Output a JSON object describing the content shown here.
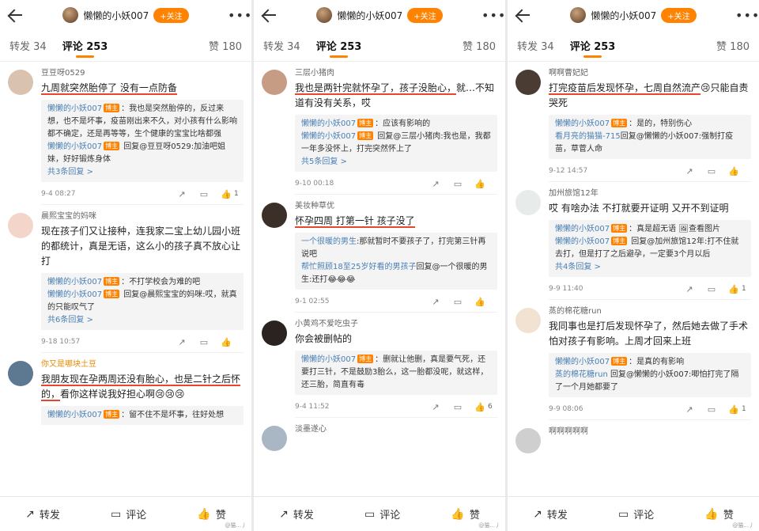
{
  "header": {
    "name": "懒懒的小妖007",
    "follow": "+关注"
  },
  "tabs": {
    "repost": "转发 34",
    "comment": "评论 253",
    "like": "赞 180"
  },
  "bottom": {
    "repost": "转发",
    "comment": "评论",
    "like": "赞"
  },
  "tag": "博主",
  "panels": [
    {
      "comments": [
        {
          "user": "豆豆呀0529",
          "text_ul": "九周就突然胎停了 没有一点防备",
          "text_rest": "",
          "replies": [
            {
              "name": "懒懒的小妖007",
              "text": "：我也是突然胎停的，反过来想，也不是坏事，疫苗刚出来不久，对小孩有什么影响都不确定，还是再等等，生个健康的宝宝比啥都强"
            },
            {
              "name": "懒懒的小妖007",
              "text": " 回复@豆豆呀0529:加油吧姐妹，好好锻炼身体"
            }
          ],
          "more": "共3条回复 >",
          "time": "9-4 08:27",
          "likes": "1"
        },
        {
          "user": "晨熙宝宝的妈咪",
          "text_ul": "",
          "text_rest": "现在孩子们又让接种，连我家二宝上幼儿园小班的都统计，真是无语，这么小的孩子真不放心让打",
          "replies": [
            {
              "name": "懒懒的小妖007",
              "text": "：不打学校会为难的吧"
            },
            {
              "name": "懒懒的小妖007",
              "text": " 回复@晨熙宝宝的妈咪:哎，就真的只能叹气了"
            }
          ],
          "more": "共6条回复 >",
          "time": "9-18 10:57",
          "likes": ""
        },
        {
          "user": "你又是哪块土豆",
          "text_ul": "我朋友现在孕两周还没有胎心，也是二针之后怀的，",
          "text_rest": "看你这样说我好担心啊😢😢😢",
          "replies": [
            {
              "name": "懒懒的小妖007",
              "text": "：留不住不是坏事，往好处想"
            }
          ],
          "more": "",
          "time": "",
          "likes": ""
        }
      ]
    },
    {
      "comments": [
        {
          "user": "三层小猪肉",
          "text_ul": "我也是两针完就怀孕了，孩子没胎心，",
          "text_rest": "就…不知道有没有关系，哎",
          "replies": [
            {
              "name": "懒懒的小妖007",
              "text": "：应该有影响的"
            },
            {
              "name": "懒懒的小妖007",
              "text": " 回复@三层小猪肉:我也是，我都一年多没怀上，打完突然怀上了"
            }
          ],
          "more": "共5条回复 >",
          "time": "9-10 00:18",
          "likes": ""
        },
        {
          "user": "美妆种草优",
          "text_ul": "怀孕四周 打第一针 孩子没了",
          "text_rest": "",
          "replies": [
            {
              "name": "一个很暖的男生",
              "text": ":那就暂时不要孩子了，打完第三针再说吧"
            },
            {
              "name": "帮忙照顾18至25岁好看的男孩子",
              "text": "回复@一个很暖的男生:还打😂😂😂"
            }
          ],
          "more": "",
          "time": "9-1 02:55",
          "likes": ""
        },
        {
          "user": "小黄鸡不爱吃虫子",
          "text_ul": "",
          "text_rest": "你会被删帖的",
          "replies": [
            {
              "name": "懒懒的小妖007",
              "text": "：删就让他删，真是要气死，还要打三针，不是鼓励3胎么，这一胎都没呢，就这样，还三胎，简直有毒"
            }
          ],
          "more": "",
          "time": "9-4 11:52",
          "likes": "6"
        },
        {
          "user": "淡墨遂心",
          "text_ul": "",
          "text_rest": "",
          "replies": [],
          "more": "",
          "time": "",
          "likes": ""
        }
      ]
    },
    {
      "comments": [
        {
          "user": "啊啊曹妃妃",
          "text_ul": "打完疫苗后发现怀孕，七周自然流产",
          "text_rest": "😢只能自责哭死",
          "replies": [
            {
              "name": "懒懒的小妖007",
              "text": "：是的，特别伤心"
            },
            {
              "name": "看月亮的猫猫-715",
              "text": "回复@懒懒的小妖007:强制打疫苗，草菅人命"
            }
          ],
          "more": "",
          "time": "9-12 14:57",
          "likes": ""
        },
        {
          "user": "加州旅馆12年",
          "text_ul": "",
          "text_rest": "哎 有啥办法 不打就要开证明 又开不到证明",
          "replies": [
            {
              "name": "懒懒的小妖007",
              "text": "：真是超无语 🖼查看图片"
            },
            {
              "name": "懒懒的小妖007",
              "text": " 回复@加州旅馆12年:打不住就去打，但是打了之后避孕，一定要3个月以后"
            }
          ],
          "more": "共4条回复 >",
          "time": "9-9 11:40",
          "likes": "1"
        },
        {
          "user": "蒸的棉花糖run",
          "text_ul": "",
          "text_rest": "我同事也是打后发现怀孕了，然后她去做了手术怕对孩子有影响。上周才回来上班",
          "replies": [
            {
              "name": "懒懒的小妖007",
              "text": "：是真的有影响"
            },
            {
              "name": "蒸的棉花糖run",
              "text": " 回复@懒懒的小妖007:唧怕打完了隔了一个月她都要了"
            }
          ],
          "more": "",
          "time": "9-9 08:06",
          "likes": "1"
        },
        {
          "user": "啊啊啊啊啊",
          "text_ul": "",
          "text_rest": "",
          "replies": [],
          "more": "",
          "time": "",
          "likes": ""
        }
      ]
    }
  ],
  "avatar_colors": [
    "#d9c3b0",
    "#f3d6c9",
    "#5d7891",
    "#c69c84",
    "#3b2f2a",
    "#2a2320",
    "#a9b6c4",
    "#4a3b33",
    "#e7ecea",
    "#f1e2d2",
    "#cfcfcf"
  ],
  "watermark": "@猫...丿"
}
